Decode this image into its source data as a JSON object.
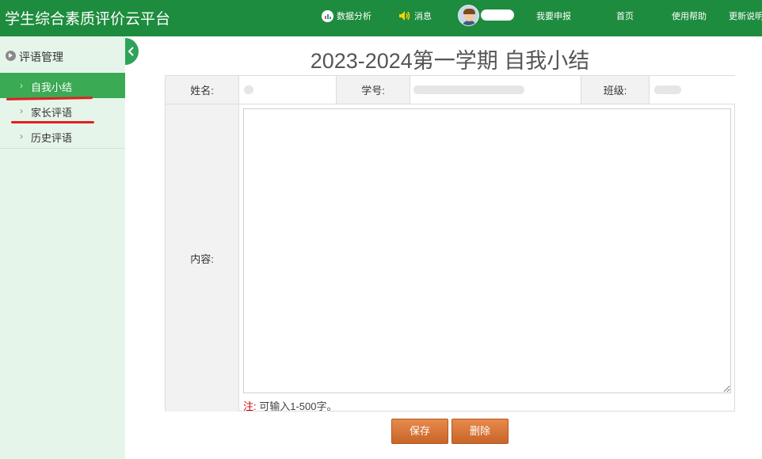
{
  "header": {
    "title": "学生综合素质评价云平台",
    "nav": {
      "data_analysis": "数据分析",
      "messages": "消息",
      "my_report": "我要申报",
      "home": "首页",
      "help": "使用帮助",
      "changelog": "更新说明"
    },
    "icons": [
      "chart-icon",
      "speaker-icon",
      "avatar"
    ]
  },
  "sidebar": {
    "section": "评语管理",
    "items": [
      {
        "label": "自我小结",
        "active": true
      },
      {
        "label": "家长评语",
        "active": false
      },
      {
        "label": "历史评语",
        "active": false
      }
    ]
  },
  "main": {
    "title": "2023-2024第一学期 自我小结",
    "form": {
      "name_label": "姓名:",
      "student_id_label": "学号:",
      "class_label": "班级:",
      "content_label": "内容:",
      "note_prefix": "注:",
      "note_text": "可输入1-500字。"
    },
    "buttons": {
      "save": "保存",
      "delete": "删除"
    }
  },
  "colors": {
    "header_bg": "#1e8c3e",
    "sidebar_bg": "#e6f5e9",
    "active_item_bg": "#3aaa55",
    "button_bg": "#e07b39",
    "annotation_red": "#e02020"
  }
}
